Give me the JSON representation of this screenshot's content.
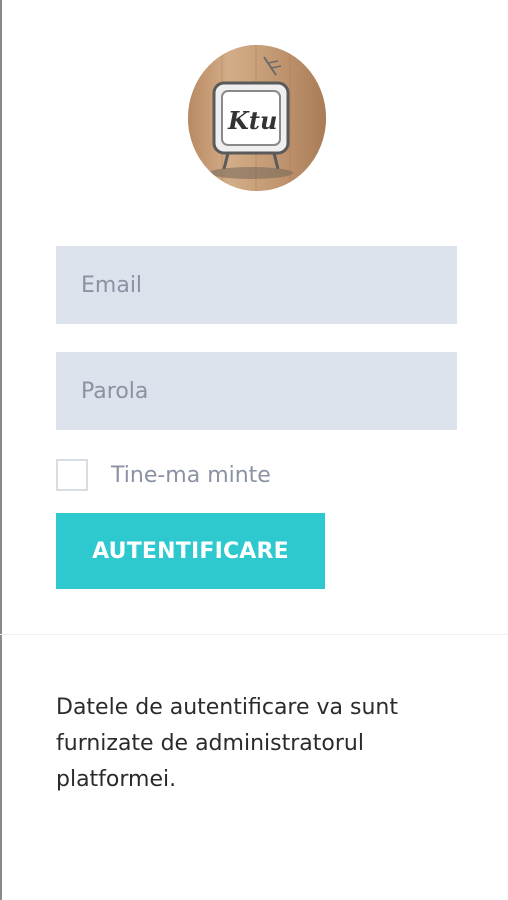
{
  "logo": {
    "text": "Ktu",
    "icon": "retro-tv-logo-icon"
  },
  "form": {
    "email_placeholder": "Email",
    "password_placeholder": "Parola",
    "remember_label": "Tine-ma minte",
    "remember_checked": false,
    "submit_label": "AUTENTIFICARE"
  },
  "footer": {
    "info_text": "Datele de autentificare va sunt furnizate de administratorul platformei."
  },
  "colors": {
    "accent": "#2ec8cf",
    "input_bg": "#dde3ec",
    "placeholder": "#8a93a3",
    "text": "#2b2b2b"
  }
}
